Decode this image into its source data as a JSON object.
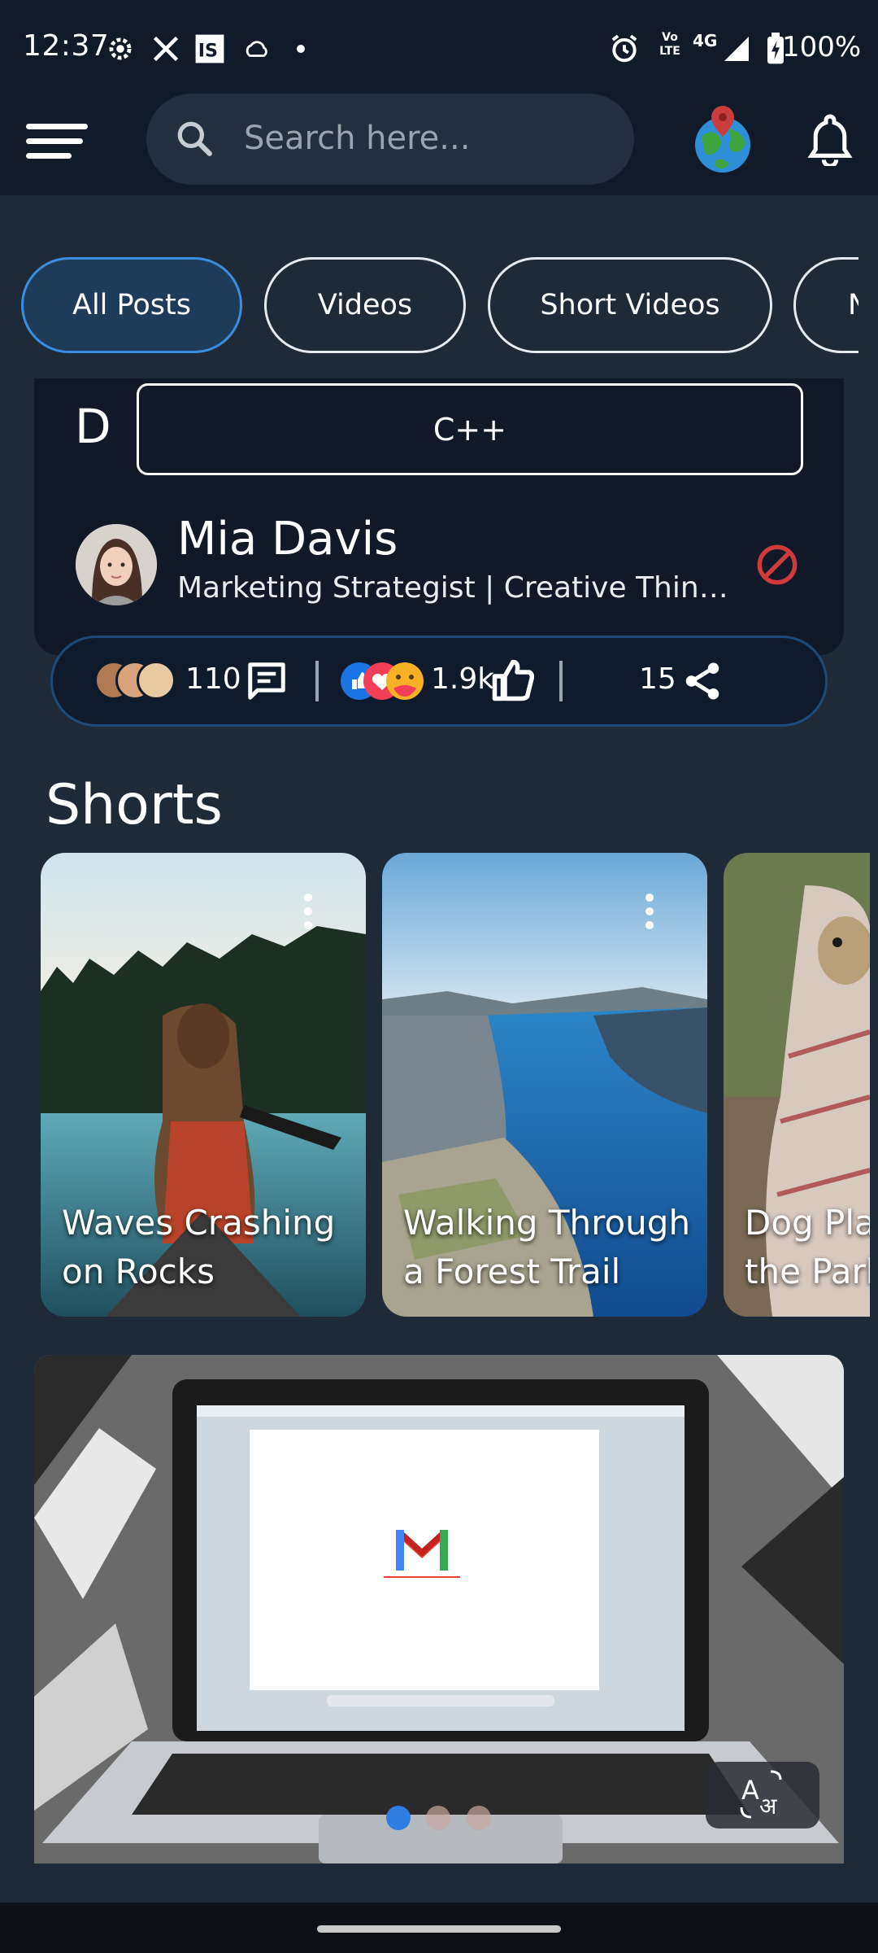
{
  "status_bar": {
    "time": "12:37",
    "network": "4G",
    "volte": "Vo LTE",
    "battery": "100%",
    "left_icons": [
      "settings-icon",
      "x-logo-icon",
      "is-app-icon",
      "cloud-icon",
      "dot-icon"
    ],
    "right_icons": [
      "alarm-icon",
      "volte-icon",
      "signal-icon",
      "battery-charging-icon"
    ]
  },
  "header": {
    "search_placeholder": "Search here...",
    "icons": [
      "menu-icon",
      "search-icon",
      "globe-location-icon",
      "bell-icon"
    ]
  },
  "filters": {
    "chips": [
      {
        "label": "All Posts",
        "active": true
      },
      {
        "label": "Videos",
        "active": false
      },
      {
        "label": "Short Videos",
        "active": false
      },
      {
        "label": "N",
        "active": false
      }
    ]
  },
  "post": {
    "letter": "D",
    "tag": "C++",
    "author_name": "Mia Davis",
    "author_title": "Marketing Strategist | Creative Thinker",
    "stats": {
      "comments": "110",
      "reactions": "1.9k",
      "shares": "15"
    }
  },
  "shorts": {
    "heading": "Shorts",
    "items": [
      {
        "title_line1": "Waves Crashing",
        "title_line2": "on Rocks"
      },
      {
        "title_line1": "Walking Through",
        "title_line2": "a Forest Trail"
      },
      {
        "title_line1": "Dog Pla",
        "title_line2": "the Park"
      }
    ]
  },
  "colors": {
    "background": "#1e2a37",
    "header": "#111a29",
    "accent": "#3a8de0",
    "active_chip": "#1f3b5a",
    "block_red": "#d13a3a"
  }
}
